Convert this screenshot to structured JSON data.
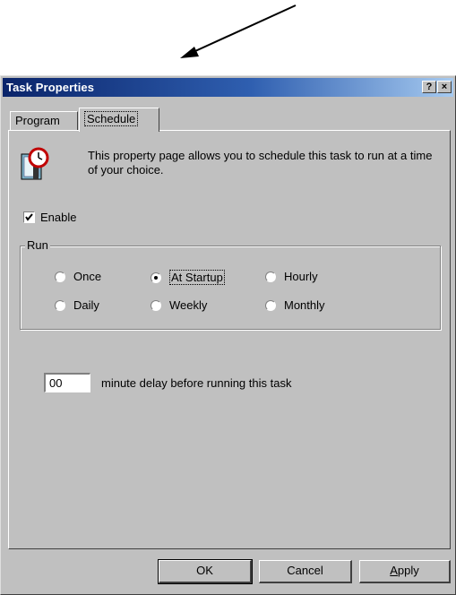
{
  "window": {
    "title": "Task Properties",
    "help_button": "?",
    "close_button": "×"
  },
  "tabs": [
    {
      "label": "Program",
      "selected": false
    },
    {
      "label": "Schedule",
      "selected": true
    }
  ],
  "schedule": {
    "icon": "calendar-clock-icon",
    "description": "This property page allows you to schedule this task to run at a time of your choice.",
    "enable": {
      "label": "Enable",
      "checked": true
    },
    "run_group": {
      "label": "Run",
      "options": [
        {
          "label": "Once",
          "selected": false
        },
        {
          "label": "At Startup",
          "selected": true
        },
        {
          "label": "Hourly",
          "selected": false
        },
        {
          "label": "Daily",
          "selected": false
        },
        {
          "label": "Weekly",
          "selected": false
        },
        {
          "label": "Monthly",
          "selected": false
        }
      ]
    },
    "delay": {
      "value": "00",
      "label": "minute delay before running this task"
    }
  },
  "buttons": {
    "ok": "OK",
    "cancel": "Cancel",
    "apply": "Apply"
  },
  "colors": {
    "titlebar_start": "#0a246a",
    "titlebar_end": "#a6caf0",
    "face": "#c0c0c0"
  }
}
